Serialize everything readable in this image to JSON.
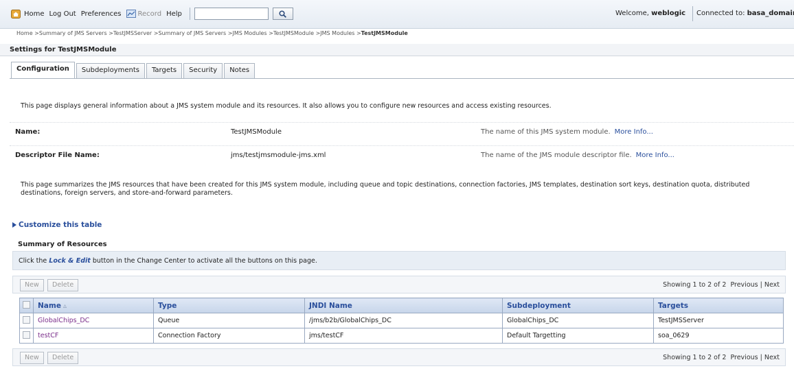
{
  "toolbar": {
    "home": "Home",
    "logout": "Log Out",
    "preferences": "Preferences",
    "record": "Record",
    "help": "Help",
    "search_value": "",
    "welcome_prefix": "Welcome, ",
    "user": "weblogic",
    "connected_prefix": "Connected to: ",
    "domain": "basa_domain"
  },
  "breadcrumb": {
    "items": [
      "Home",
      "Summary of JMS Servers",
      "TestJMSServer",
      "Summary of JMS Servers",
      "JMS Modules",
      "TestJMSModule",
      "JMS Modules"
    ],
    "separator": " >",
    "current": "TestJMSModule"
  },
  "page": {
    "title": "Settings for TestJMSModule",
    "tabs": [
      "Configuration",
      "Subdeployments",
      "Targets",
      "Security",
      "Notes"
    ],
    "active_tab": "Configuration",
    "intro": "This page displays general information about a JMS system module and its resources. It also allows you to configure new resources and access existing resources.",
    "fields": {
      "name": {
        "label": "Name:",
        "value": "TestJMSModule",
        "help": "The name of this JMS system module.",
        "more": "More Info..."
      },
      "descriptor": {
        "label": "Descriptor File Name:",
        "value": "jms/testjmsmodule-jms.xml",
        "help": "The name of the JMS module descriptor file.",
        "more": "More Info..."
      }
    },
    "summary_text": "This page summarizes the JMS resources that have been created for this JMS system module, including queue and topic destinations, connection factories, JMS templates, destination sort keys, destination quota, distributed destinations, foreign servers, and store-and-forward parameters.",
    "customize": "Customize this table"
  },
  "resources": {
    "title": "Summary of Resources",
    "lock_prefix": "Click the ",
    "lock_link": "Lock & Edit",
    "lock_suffix": " button in the Change Center to activate all the buttons on this page.",
    "new_label": "New",
    "delete_label": "Delete",
    "paging_text": "Showing 1 to 2 of 2",
    "previous": "Previous",
    "next": "Next",
    "columns": [
      "Name",
      "Type",
      "JNDI Name",
      "Subdeployment",
      "Targets"
    ],
    "rows": [
      {
        "name": "GlobalChips_DC",
        "type": "Queue",
        "jndi": "/jms/b2b/GlobalChips_DC",
        "subdeployment": "GlobalChips_DC",
        "targets": "TestJMSServer"
      },
      {
        "name": "testCF",
        "type": "Connection Factory",
        "jndi": "jms/testCF",
        "subdeployment": "Default Targetting",
        "targets": "soa_0629"
      }
    ]
  },
  "colors": {
    "link": "#2a4f9c",
    "visited_link": "#7a2d8a",
    "header_bg": "#c7d5ea"
  }
}
